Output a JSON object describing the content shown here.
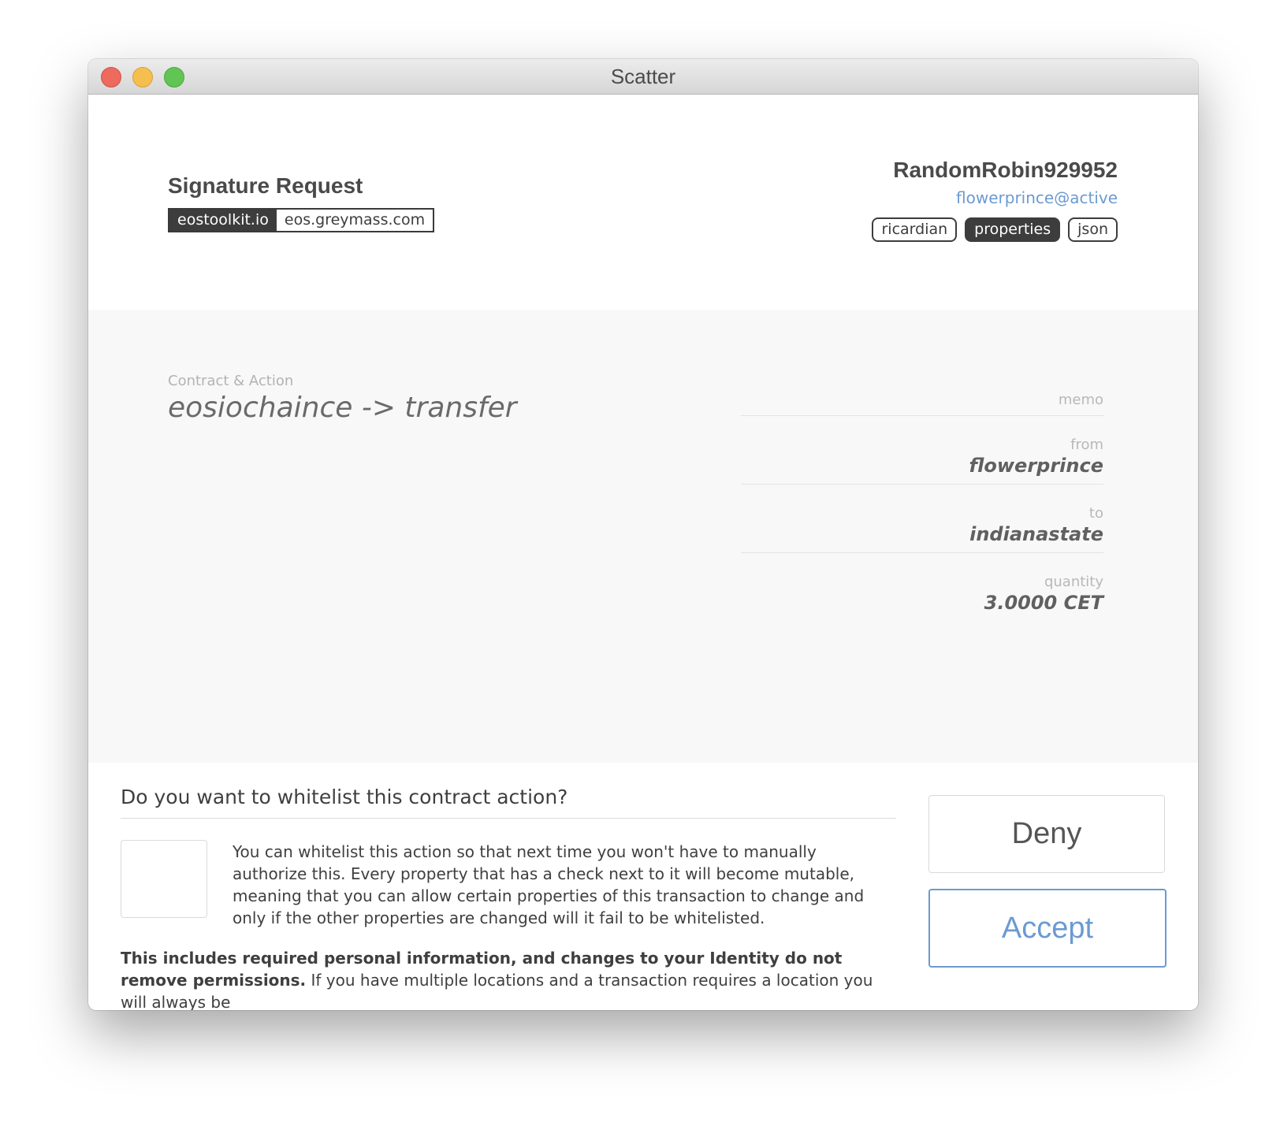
{
  "window": {
    "title": "Scatter"
  },
  "header": {
    "title": "Signature Request",
    "origin": {
      "domain": "eostoolkit.io",
      "network": "eos.greymass.com"
    },
    "account": {
      "name": "RandomRobin929952",
      "authority": "flowerprince@active"
    },
    "view_tabs": [
      {
        "label": "ricardian",
        "active": false
      },
      {
        "label": "properties",
        "active": true
      },
      {
        "label": "json",
        "active": false
      }
    ]
  },
  "action": {
    "label": "Contract & Action",
    "value": "eosiochaince -> transfer",
    "properties": [
      {
        "key": "memo",
        "value": ""
      },
      {
        "key": "from",
        "value": "flowerprince"
      },
      {
        "key": "to",
        "value": "indianastate"
      },
      {
        "key": "quantity",
        "value": "3.0000 CET"
      }
    ]
  },
  "whitelist": {
    "question": "Do you want to whitelist this contract action?",
    "description": "You can whitelist this action so that next time you won't have to manually authorize this. Every property that has a check next to it will become mutable, meaning that you can allow certain properties of this transaction to change and only if the other properties are changed will it fail to be whitelisted.",
    "note_bold": "This includes required personal information, and changes to your Identity do not remove permissions.",
    "note_rest": " If you have multiple locations and a transaction requires a location you will always be"
  },
  "buttons": {
    "deny": "Deny",
    "accept": "Accept"
  },
  "colors": {
    "accent": "#6c9ad2",
    "dark": "#3d3d3d",
    "panel_bg": "#f8f8f8"
  }
}
